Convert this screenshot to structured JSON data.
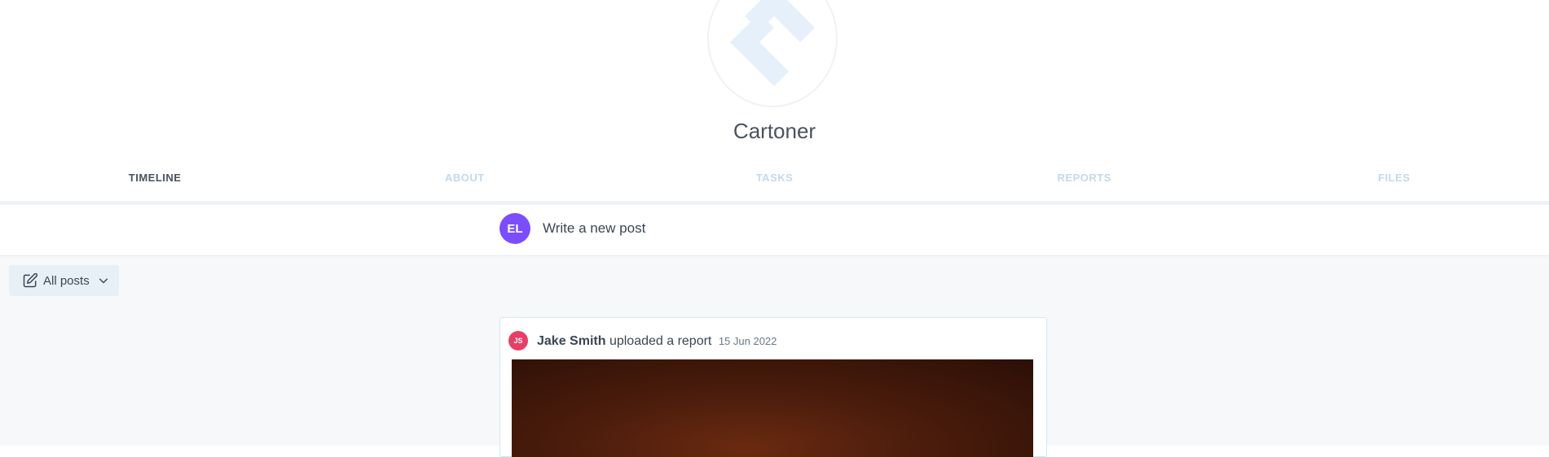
{
  "company": {
    "name": "Cartoner",
    "logo_icon": "diamond-logo-icon"
  },
  "tabs": [
    {
      "label": "TIMELINE",
      "active": true
    },
    {
      "label": "ABOUT",
      "active": false
    },
    {
      "label": "TASKS",
      "active": false
    },
    {
      "label": "REPORTS",
      "active": false
    },
    {
      "label": "FILES",
      "active": false
    }
  ],
  "composer": {
    "avatar_initials": "EL",
    "placeholder": "Write a new post"
  },
  "filter": {
    "label": "All posts",
    "icon": "edit-icon"
  },
  "post": {
    "avatar_initials": "JS",
    "author": "Jake Smith",
    "action": "uploaded a report",
    "date": "15 Jun 2022"
  },
  "colors": {
    "accent": "#8b5cf6",
    "avatar_el": "#7c4dff",
    "avatar_js": "#e83e66",
    "tab_inactive": "#c4d9ea"
  }
}
